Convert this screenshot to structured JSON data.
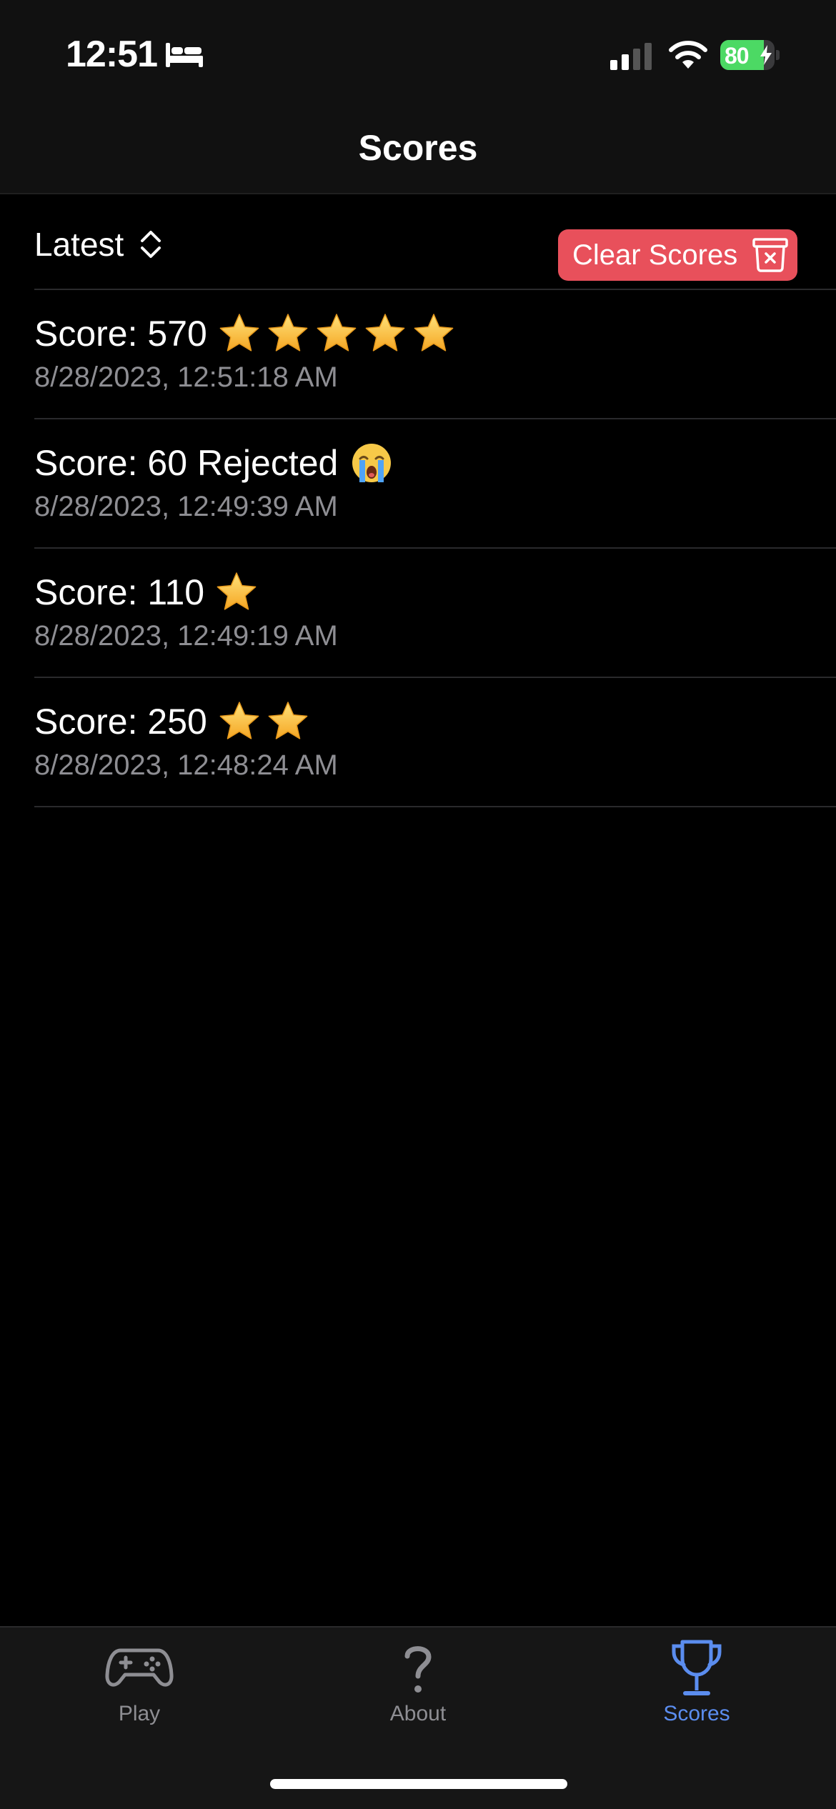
{
  "status_bar": {
    "time": "12:51",
    "battery": "80",
    "battery_level": 0.8,
    "icons": [
      "bed-icon",
      "cellular-signal-icon",
      "wifi-icon",
      "battery-charging-icon"
    ]
  },
  "nav": {
    "title": "Scores"
  },
  "controls": {
    "sort_label": "Latest",
    "clear_label": "Clear Scores",
    "accent_color": "#e8505b"
  },
  "scores": [
    {
      "title": "Score: 570",
      "stars": 5,
      "status": "",
      "date": "8/28/2023, 12:51:18 AM"
    },
    {
      "title": "Score: 60",
      "stars": 0,
      "status": "Rejected",
      "date": "8/28/2023, 12:49:39 AM"
    },
    {
      "title": "Score: 110",
      "stars": 1,
      "status": "",
      "date": "8/28/2023, 12:49:19 AM"
    },
    {
      "title": "Score: 250",
      "stars": 2,
      "status": "",
      "date": "8/28/2023, 12:48:24 AM"
    }
  ],
  "tab_bar": {
    "active_color": "#5b8def",
    "tabs": [
      {
        "label": "Play",
        "icon": "gamecontroller-icon"
      },
      {
        "label": "About",
        "icon": "question-mark-icon"
      },
      {
        "label": "Scores",
        "icon": "trophy-icon"
      }
    ],
    "active_tab": "Scores"
  }
}
